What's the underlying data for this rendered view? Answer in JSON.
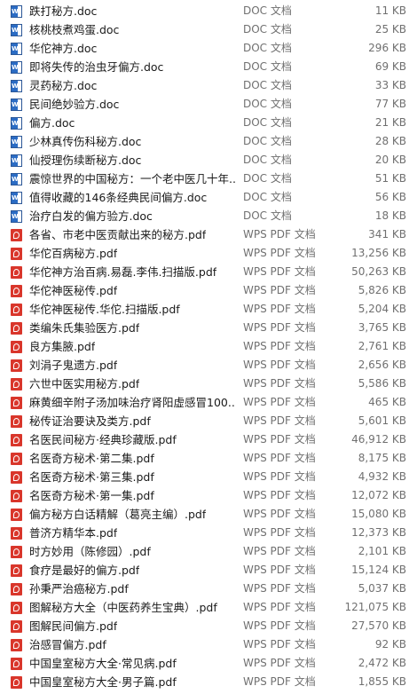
{
  "files": [
    {
      "name": "跌打秘方.doc",
      "type": "DOC 文档",
      "size": "11 KB",
      "icon": "word-doc-icon"
    },
    {
      "name": "核桃枝煮鸡蛋.doc",
      "type": "DOC 文档",
      "size": "25 KB",
      "icon": "word-doc-icon"
    },
    {
      "name": "华佗神方.doc",
      "type": "DOC 文档",
      "size": "296 KB",
      "icon": "word-doc-icon"
    },
    {
      "name": "即将失传的治虫牙偏方.doc",
      "type": "DOC 文档",
      "size": "69 KB",
      "icon": "word-doc-icon"
    },
    {
      "name": "灵药秘方.doc",
      "type": "DOC 文档",
      "size": "33 KB",
      "icon": "word-doc-icon"
    },
    {
      "name": "民间绝妙验方.doc",
      "type": "DOC 文档",
      "size": "77 KB",
      "icon": "word-doc-icon"
    },
    {
      "name": "偏方.doc",
      "type": "DOC 文档",
      "size": "21 KB",
      "icon": "word-doc-icon"
    },
    {
      "name": "少林真传伤科秘方.doc",
      "type": "DOC 文档",
      "size": "28 KB",
      "icon": "word-doc-icon"
    },
    {
      "name": "仙授理伤续断秘方.doc",
      "type": "DOC 文档",
      "size": "20 KB",
      "icon": "word-doc-icon"
    },
    {
      "name": "震惊世界的中国秘方：一个老中医几十年...",
      "type": "DOC 文档",
      "size": "51 KB",
      "icon": "word-doc-icon"
    },
    {
      "name": "值得收藏的146条经典民间偏方.doc",
      "type": "DOC 文档",
      "size": "56 KB",
      "icon": "word-doc-icon"
    },
    {
      "name": "治疗白发的偏方验方.doc",
      "type": "DOC 文档",
      "size": "18 KB",
      "icon": "word-doc-icon"
    },
    {
      "name": "各省、市老中医贡献出来的秘方.pdf",
      "type": "WPS PDF 文档",
      "size": "341 KB",
      "icon": "pdf-icon"
    },
    {
      "name": "华佗百病秘方.pdf",
      "type": "WPS PDF 文档",
      "size": "13,256 KB",
      "icon": "pdf-icon"
    },
    {
      "name": "华佗神方治百病.易磊.李伟.扫描版.pdf",
      "type": "WPS PDF 文档",
      "size": "50,263 KB",
      "icon": "pdf-icon"
    },
    {
      "name": "华佗神医秘传.pdf",
      "type": "WPS PDF 文档",
      "size": "5,826 KB",
      "icon": "pdf-icon"
    },
    {
      "name": "华佗神医秘传.华佗.扫描版.pdf",
      "type": "WPS PDF 文档",
      "size": "5,204 KB",
      "icon": "pdf-icon"
    },
    {
      "name": "类编朱氏集验医方.pdf",
      "type": "WPS PDF 文档",
      "size": "3,765 KB",
      "icon": "pdf-icon"
    },
    {
      "name": "良方集腋.pdf",
      "type": "WPS PDF 文档",
      "size": "2,761 KB",
      "icon": "pdf-icon"
    },
    {
      "name": "刘涓子鬼遗方.pdf",
      "type": "WPS PDF 文档",
      "size": "2,656 KB",
      "icon": "pdf-icon"
    },
    {
      "name": "六世中医实用秘方.pdf",
      "type": "WPS PDF 文档",
      "size": "5,586 KB",
      "icon": "pdf-icon"
    },
    {
      "name": "麻黄细辛附子汤加味治疗肾阳虚感冒100...",
      "type": "WPS PDF 文档",
      "size": "465 KB",
      "icon": "pdf-icon"
    },
    {
      "name": "秘传证治要诀及类方.pdf",
      "type": "WPS PDF 文档",
      "size": "5,601 KB",
      "icon": "pdf-icon"
    },
    {
      "name": "名医民间秘方·经典珍藏版.pdf",
      "type": "WPS PDF 文档",
      "size": "46,912 KB",
      "icon": "pdf-icon"
    },
    {
      "name": "名医奇方秘术·第二集.pdf",
      "type": "WPS PDF 文档",
      "size": "8,175 KB",
      "icon": "pdf-icon"
    },
    {
      "name": "名医奇方秘术·第三集.pdf",
      "type": "WPS PDF 文档",
      "size": "4,932 KB",
      "icon": "pdf-icon"
    },
    {
      "name": "名医奇方秘术·第一集.pdf",
      "type": "WPS PDF 文档",
      "size": "12,072 KB",
      "icon": "pdf-icon"
    },
    {
      "name": "偏方秘方白话精解（葛亮主编）.pdf",
      "type": "WPS PDF 文档",
      "size": "15,080 KB",
      "icon": "pdf-icon"
    },
    {
      "name": "普济方精华本.pdf",
      "type": "WPS PDF 文档",
      "size": "12,373 KB",
      "icon": "pdf-icon"
    },
    {
      "name": "时方妙用（陈修园）.pdf",
      "type": "WPS PDF 文档",
      "size": "2,101 KB",
      "icon": "pdf-icon"
    },
    {
      "name": "食疗是最好的偏方.pdf",
      "type": "WPS PDF 文档",
      "size": "15,124 KB",
      "icon": "pdf-icon"
    },
    {
      "name": "孙秉严治癌秘方.pdf",
      "type": "WPS PDF 文档",
      "size": "5,037 KB",
      "icon": "pdf-icon"
    },
    {
      "name": "图解秘方大全（中医药养生宝典）.pdf",
      "type": "WPS PDF 文档",
      "size": "121,075 KB",
      "icon": "pdf-icon"
    },
    {
      "name": "图解民间偏方.pdf",
      "type": "WPS PDF 文档",
      "size": "27,570 KB",
      "icon": "pdf-icon"
    },
    {
      "name": "治感冒偏方.pdf",
      "type": "WPS PDF 文档",
      "size": "92 KB",
      "icon": "pdf-icon"
    },
    {
      "name": "中国皇室秘方大全·常见病.pdf",
      "type": "WPS PDF 文档",
      "size": "2,472 KB",
      "icon": "pdf-icon"
    },
    {
      "name": "中国皇室秘方大全·男子篇.pdf",
      "type": "WPS PDF 文档",
      "size": "1,855 KB",
      "icon": "pdf-icon"
    }
  ]
}
